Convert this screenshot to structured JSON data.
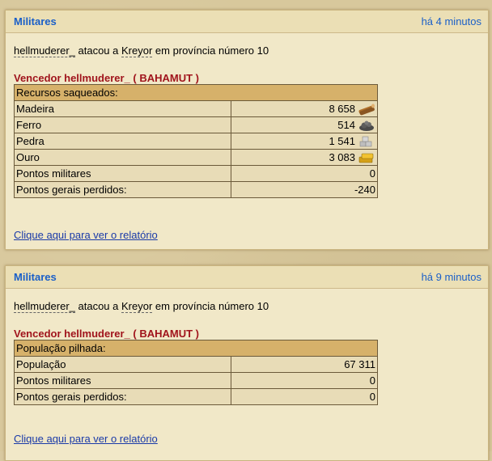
{
  "panels": [
    {
      "title": "Militares",
      "time": "há 4 minutos",
      "attacker": "hellmuderer_",
      "verb": "atacou a",
      "defender": "Kreyor",
      "location": "em província número 10",
      "winner": "Vencedor hellmuderer_  ( BAHAMUT )",
      "table_header": "Recursos saqueados:",
      "rows": [
        {
          "label": "Madeira",
          "value": "8 658",
          "icon": "wood-icon"
        },
        {
          "label": "Ferro",
          "value": "514",
          "icon": "iron-icon"
        },
        {
          "label": "Pedra",
          "value": "1 541",
          "icon": "stone-icon"
        },
        {
          "label": "Ouro",
          "value": "3 083",
          "icon": "gold-icon"
        },
        {
          "label": "Pontos militares",
          "value": "0"
        },
        {
          "label": "Pontos gerais perdidos:",
          "value": "-240"
        }
      ],
      "link": "Clique aqui para ver o relatório"
    },
    {
      "title": "Militares",
      "time": "há 9 minutos",
      "attacker": "hellmuderer_",
      "verb": "atacou a",
      "defender": "Kreyor",
      "location": "em província número 10",
      "winner": "Vencedor hellmuderer_  ( BAHAMUT )",
      "table_header": "População pilhada:",
      "rows": [
        {
          "label": "População",
          "value": "67 311"
        },
        {
          "label": "Pontos militares",
          "value": "0"
        },
        {
          "label": "Pontos gerais perdidos:",
          "value": "0"
        }
      ],
      "link": "Clique aqui para ver o relatório"
    }
  ],
  "colors": {
    "title_blue": "#1a5fc8",
    "winner_red": "#a0141c",
    "link_blue": "#1a3aa8",
    "table_head": "#d6b16a",
    "table_row": "#e8dcb7"
  }
}
